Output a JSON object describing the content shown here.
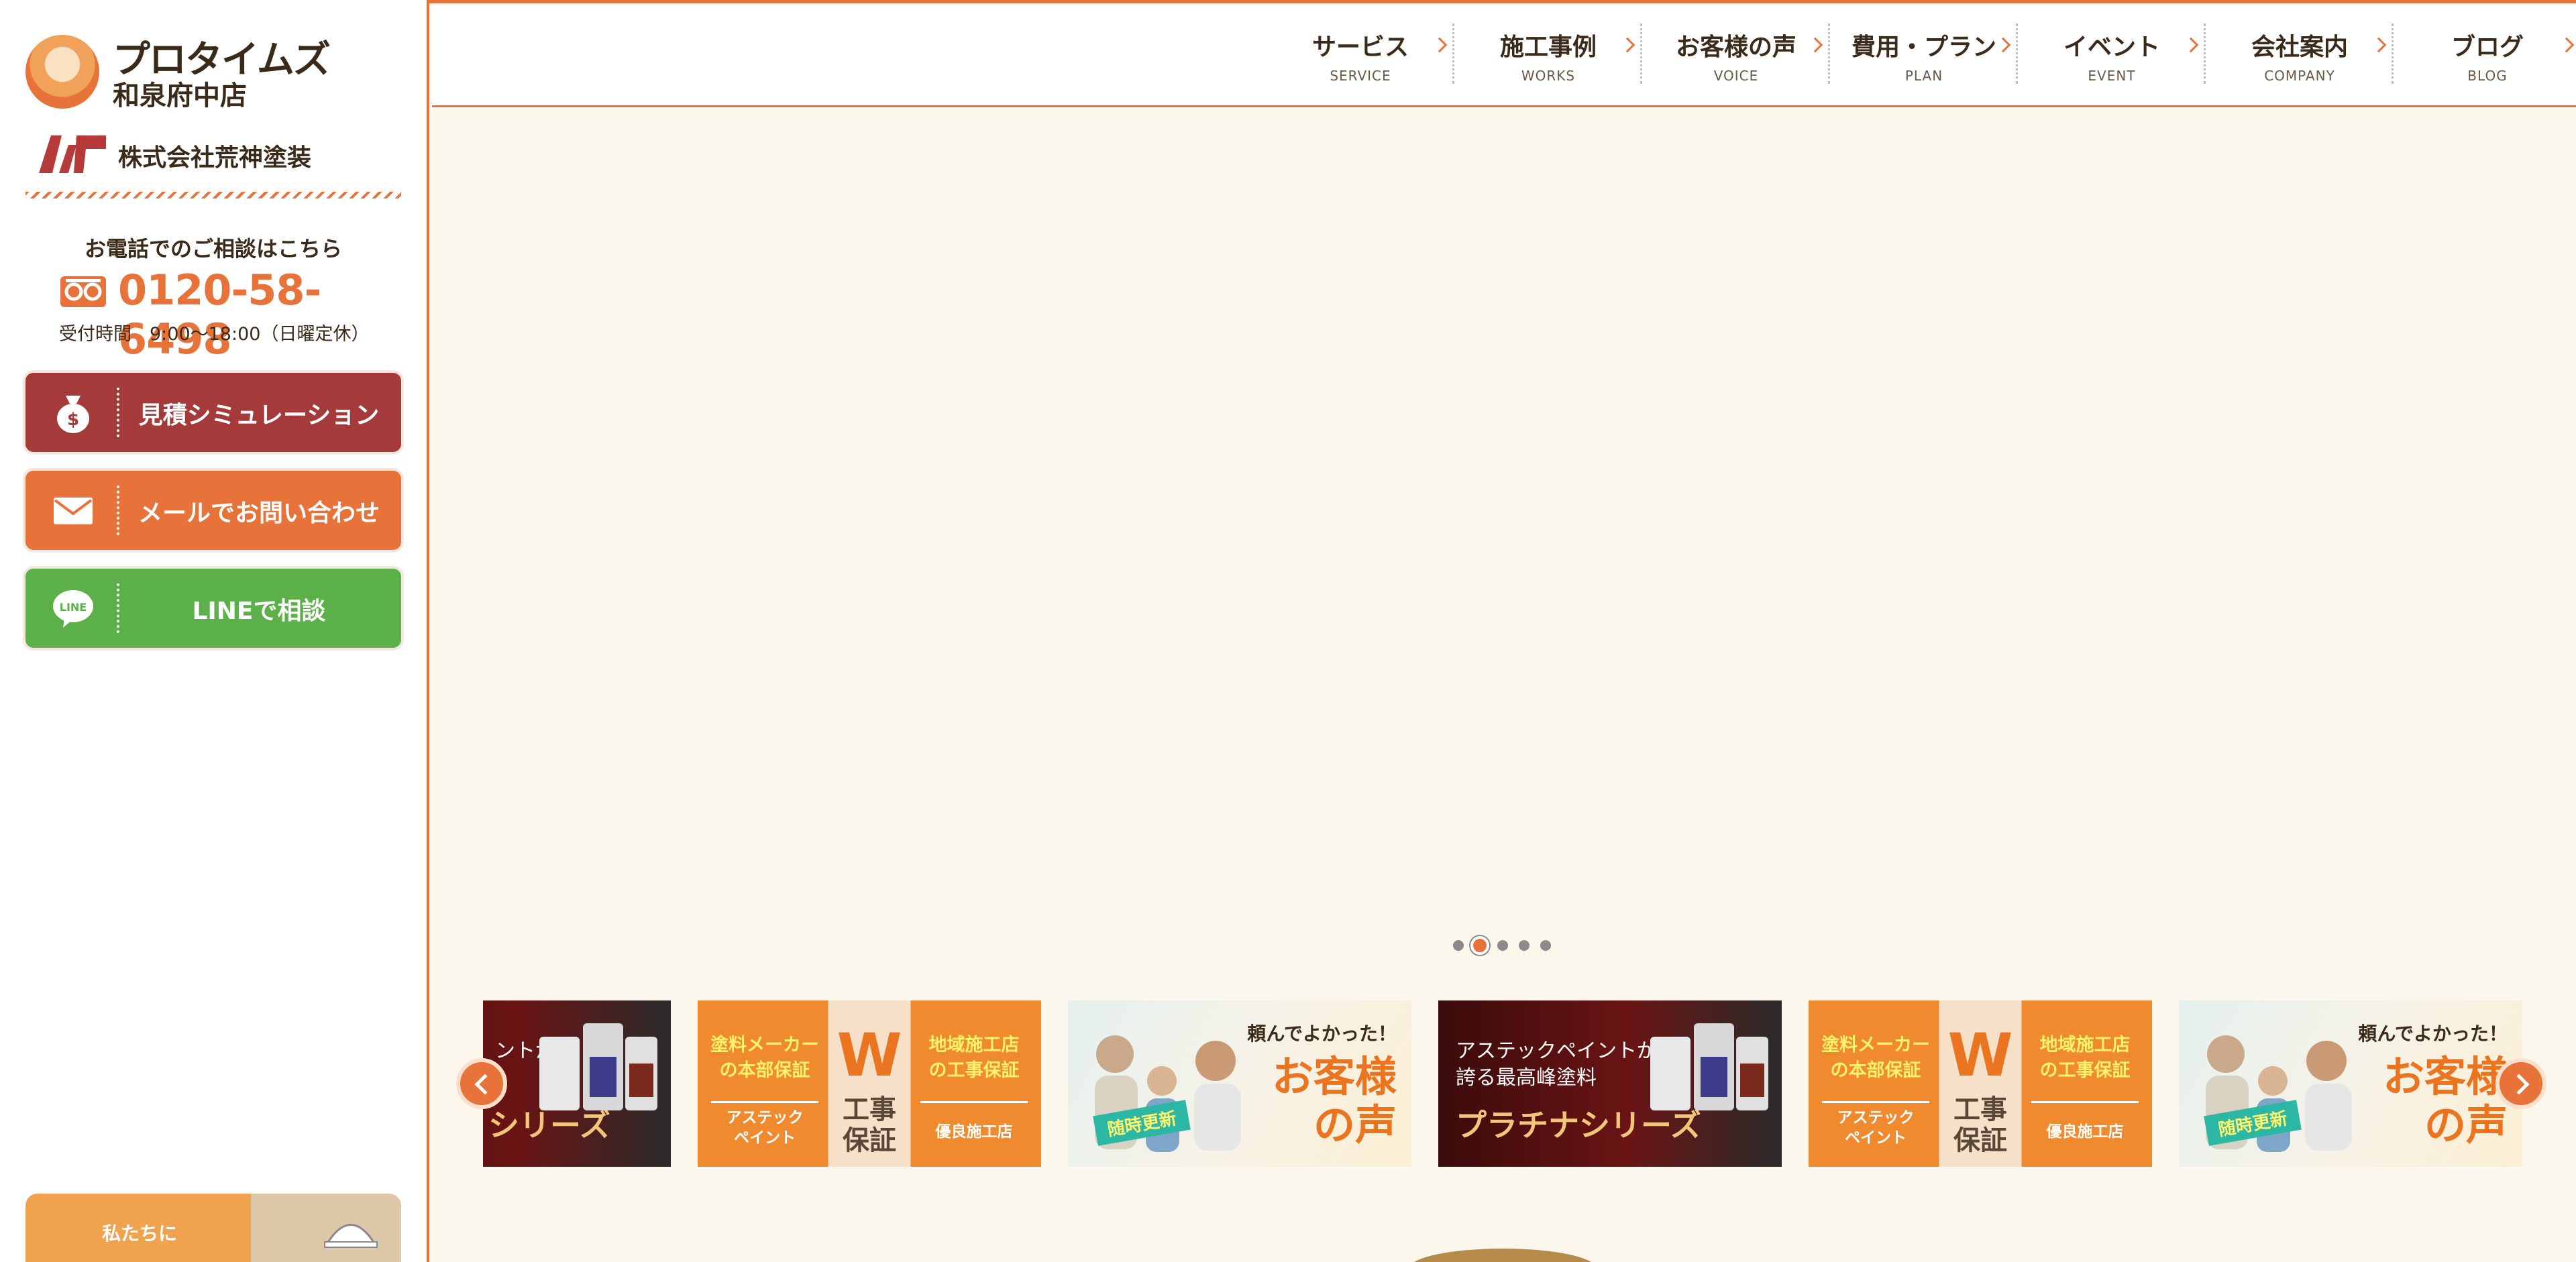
{
  "brand": {
    "name": "プロタイムズ",
    "branch": "和泉府中店",
    "company": "株式会社荒神塗装"
  },
  "contact": {
    "label": "お電話でのご相談はこちら",
    "phone": "0120-58-6498",
    "hours": "受付時間　9:00〜18:00（日曜定休）"
  },
  "side_buttons": [
    {
      "label": "見積シミュレーション",
      "icon": "money-bag-icon",
      "color": "#a53a3a"
    },
    {
      "label": "メールでお問い合わせ",
      "icon": "mail-icon",
      "color": "#e8733a"
    },
    {
      "label": "LINEで相談",
      "icon": "line-icon",
      "color": "#5bb04a"
    }
  ],
  "promo": {
    "text": "私たちに"
  },
  "nav": [
    {
      "jp": "サービス",
      "en": "SERVICE"
    },
    {
      "jp": "施工事例",
      "en": "WORKS"
    },
    {
      "jp": "お客様の声",
      "en": "VOICE"
    },
    {
      "jp": "費用・プラン",
      "en": "PLAN"
    },
    {
      "jp": "イベント",
      "en": "EVENT"
    },
    {
      "jp": "会社案内",
      "en": "COMPANY"
    },
    {
      "jp": "ブログ",
      "en": "BLOG"
    }
  ],
  "carousel": {
    "slide_count": 5,
    "active_index": 1
  },
  "banners": {
    "platinum": {
      "sub": "アステックペイントが\n誇る最高峰塗料",
      "main": "プラチナシリーズ"
    },
    "platinum_partial": {
      "sub": "ントが",
      "main": "シリーズ"
    },
    "warranty": {
      "left_top": "塗料メーカー\nの本部保証",
      "left_bottom": "アステック\nペイント",
      "right_top": "地域施工店\nの工事保証",
      "right_bottom": "優良施工店",
      "w": "W",
      "center": "工事\n保証"
    },
    "voice": {
      "top": "頼んでよかった！",
      "big": "お客様\nの声",
      "tag": "随時更新"
    }
  },
  "colors": {
    "accent": "#e8733a",
    "background": "#fcf7ec",
    "text": "#3a2a1a"
  }
}
